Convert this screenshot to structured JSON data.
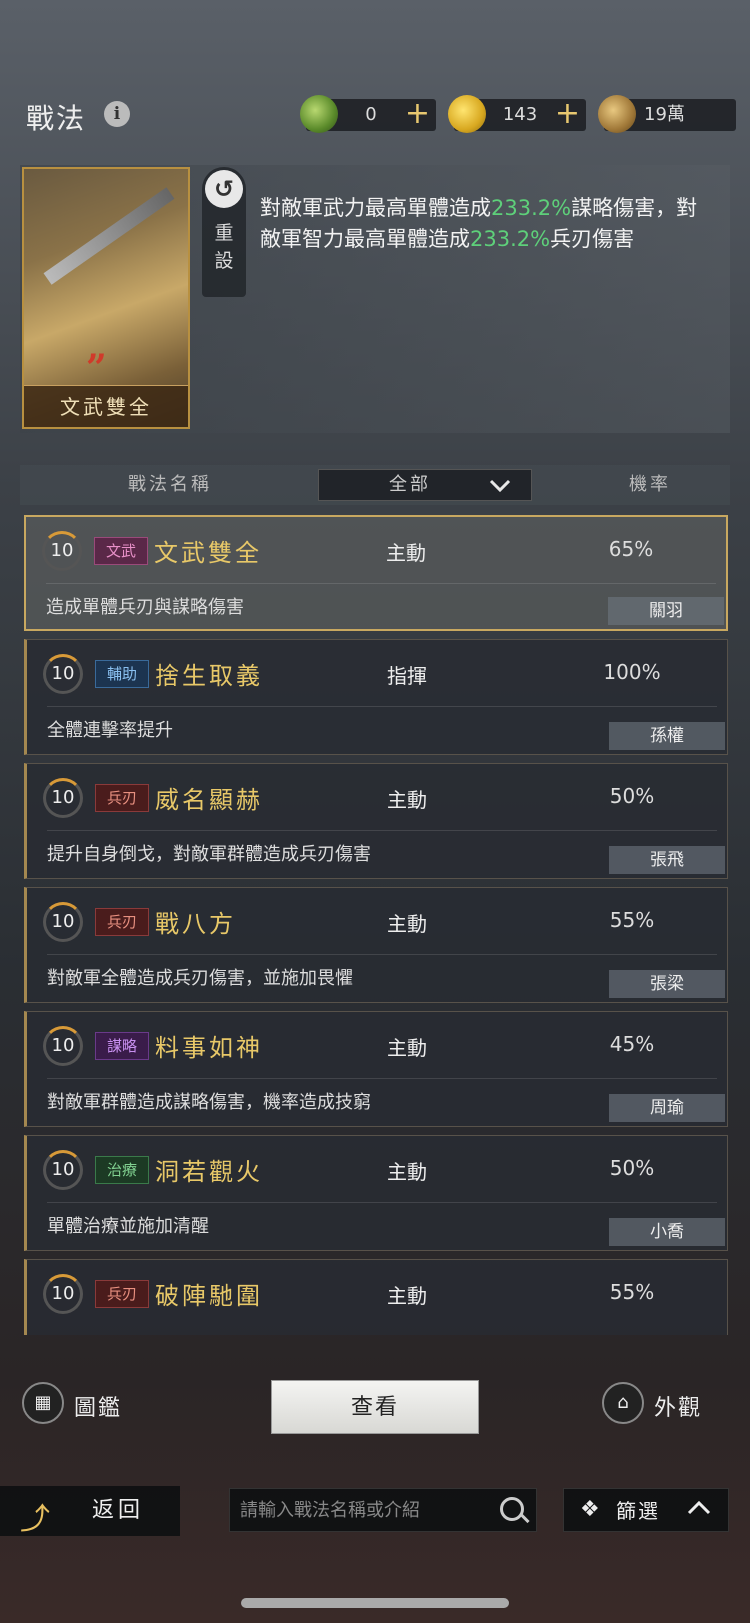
{
  "header": {
    "title": "戰法",
    "info_icon": "i",
    "currencies": [
      {
        "icon": "jade-coin-icon",
        "value": "0",
        "plus": "+"
      },
      {
        "icon": "gold-coin-icon",
        "value": "143",
        "plus": "+"
      },
      {
        "icon": "copper-coin-icon",
        "value": "19萬"
      }
    ]
  },
  "detail": {
    "card_name": "文武雙全",
    "reset_label": "重設",
    "desc_parts": [
      "對敵軍武力最高單體造成",
      "233.2%",
      "謀略傷害，對敵軍智力最高單體造成",
      "233.2%",
      "兵刃傷害"
    ]
  },
  "table_header": {
    "col_name": "戰法名稱",
    "filter_value": "全部",
    "col_rate": "機率"
  },
  "tactics": [
    {
      "level": "10",
      "tag": "文武",
      "tag_class": "wenwu",
      "name": "文武雙全",
      "type": "主動",
      "rate": "65%",
      "desc": "造成單體兵刃與謀略傷害",
      "hero": "關羽"
    },
    {
      "level": "10",
      "tag": "輔助",
      "tag_class": "fuzhu",
      "name": "捨生取義",
      "type": "指揮",
      "rate": "100%",
      "desc": "全體連擊率提升",
      "hero": "孫權"
    },
    {
      "level": "10",
      "tag": "兵刃",
      "tag_class": "bingren",
      "name": "威名顯赫",
      "type": "主動",
      "rate": "50%",
      "desc": "提升自身倒戈，對敵軍群體造成兵刃傷害",
      "hero": "張飛"
    },
    {
      "level": "10",
      "tag": "兵刃",
      "tag_class": "bingren",
      "name": "戰八方",
      "type": "主動",
      "rate": "55%",
      "desc": "對敵軍全體造成兵刃傷害，並施加畏懼",
      "hero": "張梁"
    },
    {
      "level": "10",
      "tag": "謀略",
      "tag_class": "moulue",
      "name": "料事如神",
      "type": "主動",
      "rate": "45%",
      "desc": "對敵軍群體造成謀略傷害，機率造成技窮",
      "hero": "周瑜"
    },
    {
      "level": "10",
      "tag": "治療",
      "tag_class": "zhiliao",
      "name": "洞若觀火",
      "type": "主動",
      "rate": "50%",
      "desc": "單體治療並施加清醒",
      "hero": "小喬"
    },
    {
      "level": "10",
      "tag": "兵刃",
      "tag_class": "bingren",
      "name": "破陣馳圍",
      "type": "主動",
      "rate": "55%",
      "desc": "",
      "hero": ""
    }
  ],
  "actions": {
    "codex_label": "圖鑑",
    "view_label": "查看",
    "appearance_label": "外觀"
  },
  "bottom": {
    "back_label": "返回",
    "search_placeholder": "請輸入戰法名稱或介紹",
    "filter_label": "篩選"
  }
}
